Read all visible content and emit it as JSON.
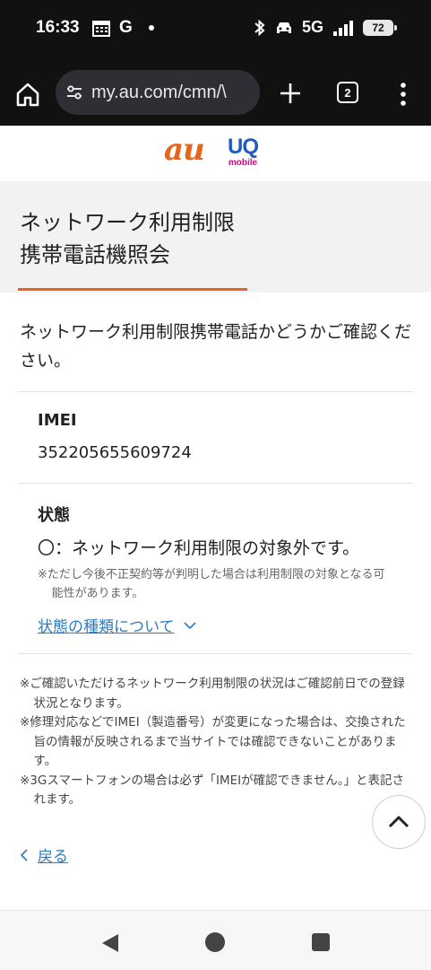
{
  "status_bar": {
    "time": "16:33",
    "g_label": "G",
    "network": "5G",
    "battery": "72"
  },
  "browser": {
    "url": "my.au.com/cmn/\\",
    "tab_count": "2"
  },
  "brand": {
    "au": "au",
    "uq": "UQ",
    "uq_sub": "mobile",
    "au_color": "#e8641b",
    "uq_color": "#1f5bc2",
    "uq_sub_color": "#d6008a"
  },
  "page": {
    "title_line1": "ネットワーク利用制限",
    "title_line2": "携帯電話機照会",
    "intro": "ネットワーク利用制限携帯電話かどうかご確認ください。"
  },
  "imei": {
    "label": "IMEI",
    "value": "352205655609724"
  },
  "status": {
    "label": "状態",
    "result": "〇：ネットワーク利用制限の対象外です。",
    "note": "※ただし今後不正契約等が判明した場合は利用制限の対象となる可能性があります。",
    "link": "状態の種類について"
  },
  "notes": [
    "※ご確認いただけるネットワーク利用制限の状況はご確認前日での登録状況となります。",
    "※修理対応などでIMEI（製造番号）が変更になった場合は、交換された旨の情報が反映されるまで当サイトでは確認できないことがあります。",
    "※3Gスマートフォンの場合は必ず「IMEIが確認できません。」と表記されます。"
  ],
  "back": {
    "label": "戻る"
  },
  "colors": {
    "accent": "#e8641b",
    "link": "#2d7bbf"
  }
}
